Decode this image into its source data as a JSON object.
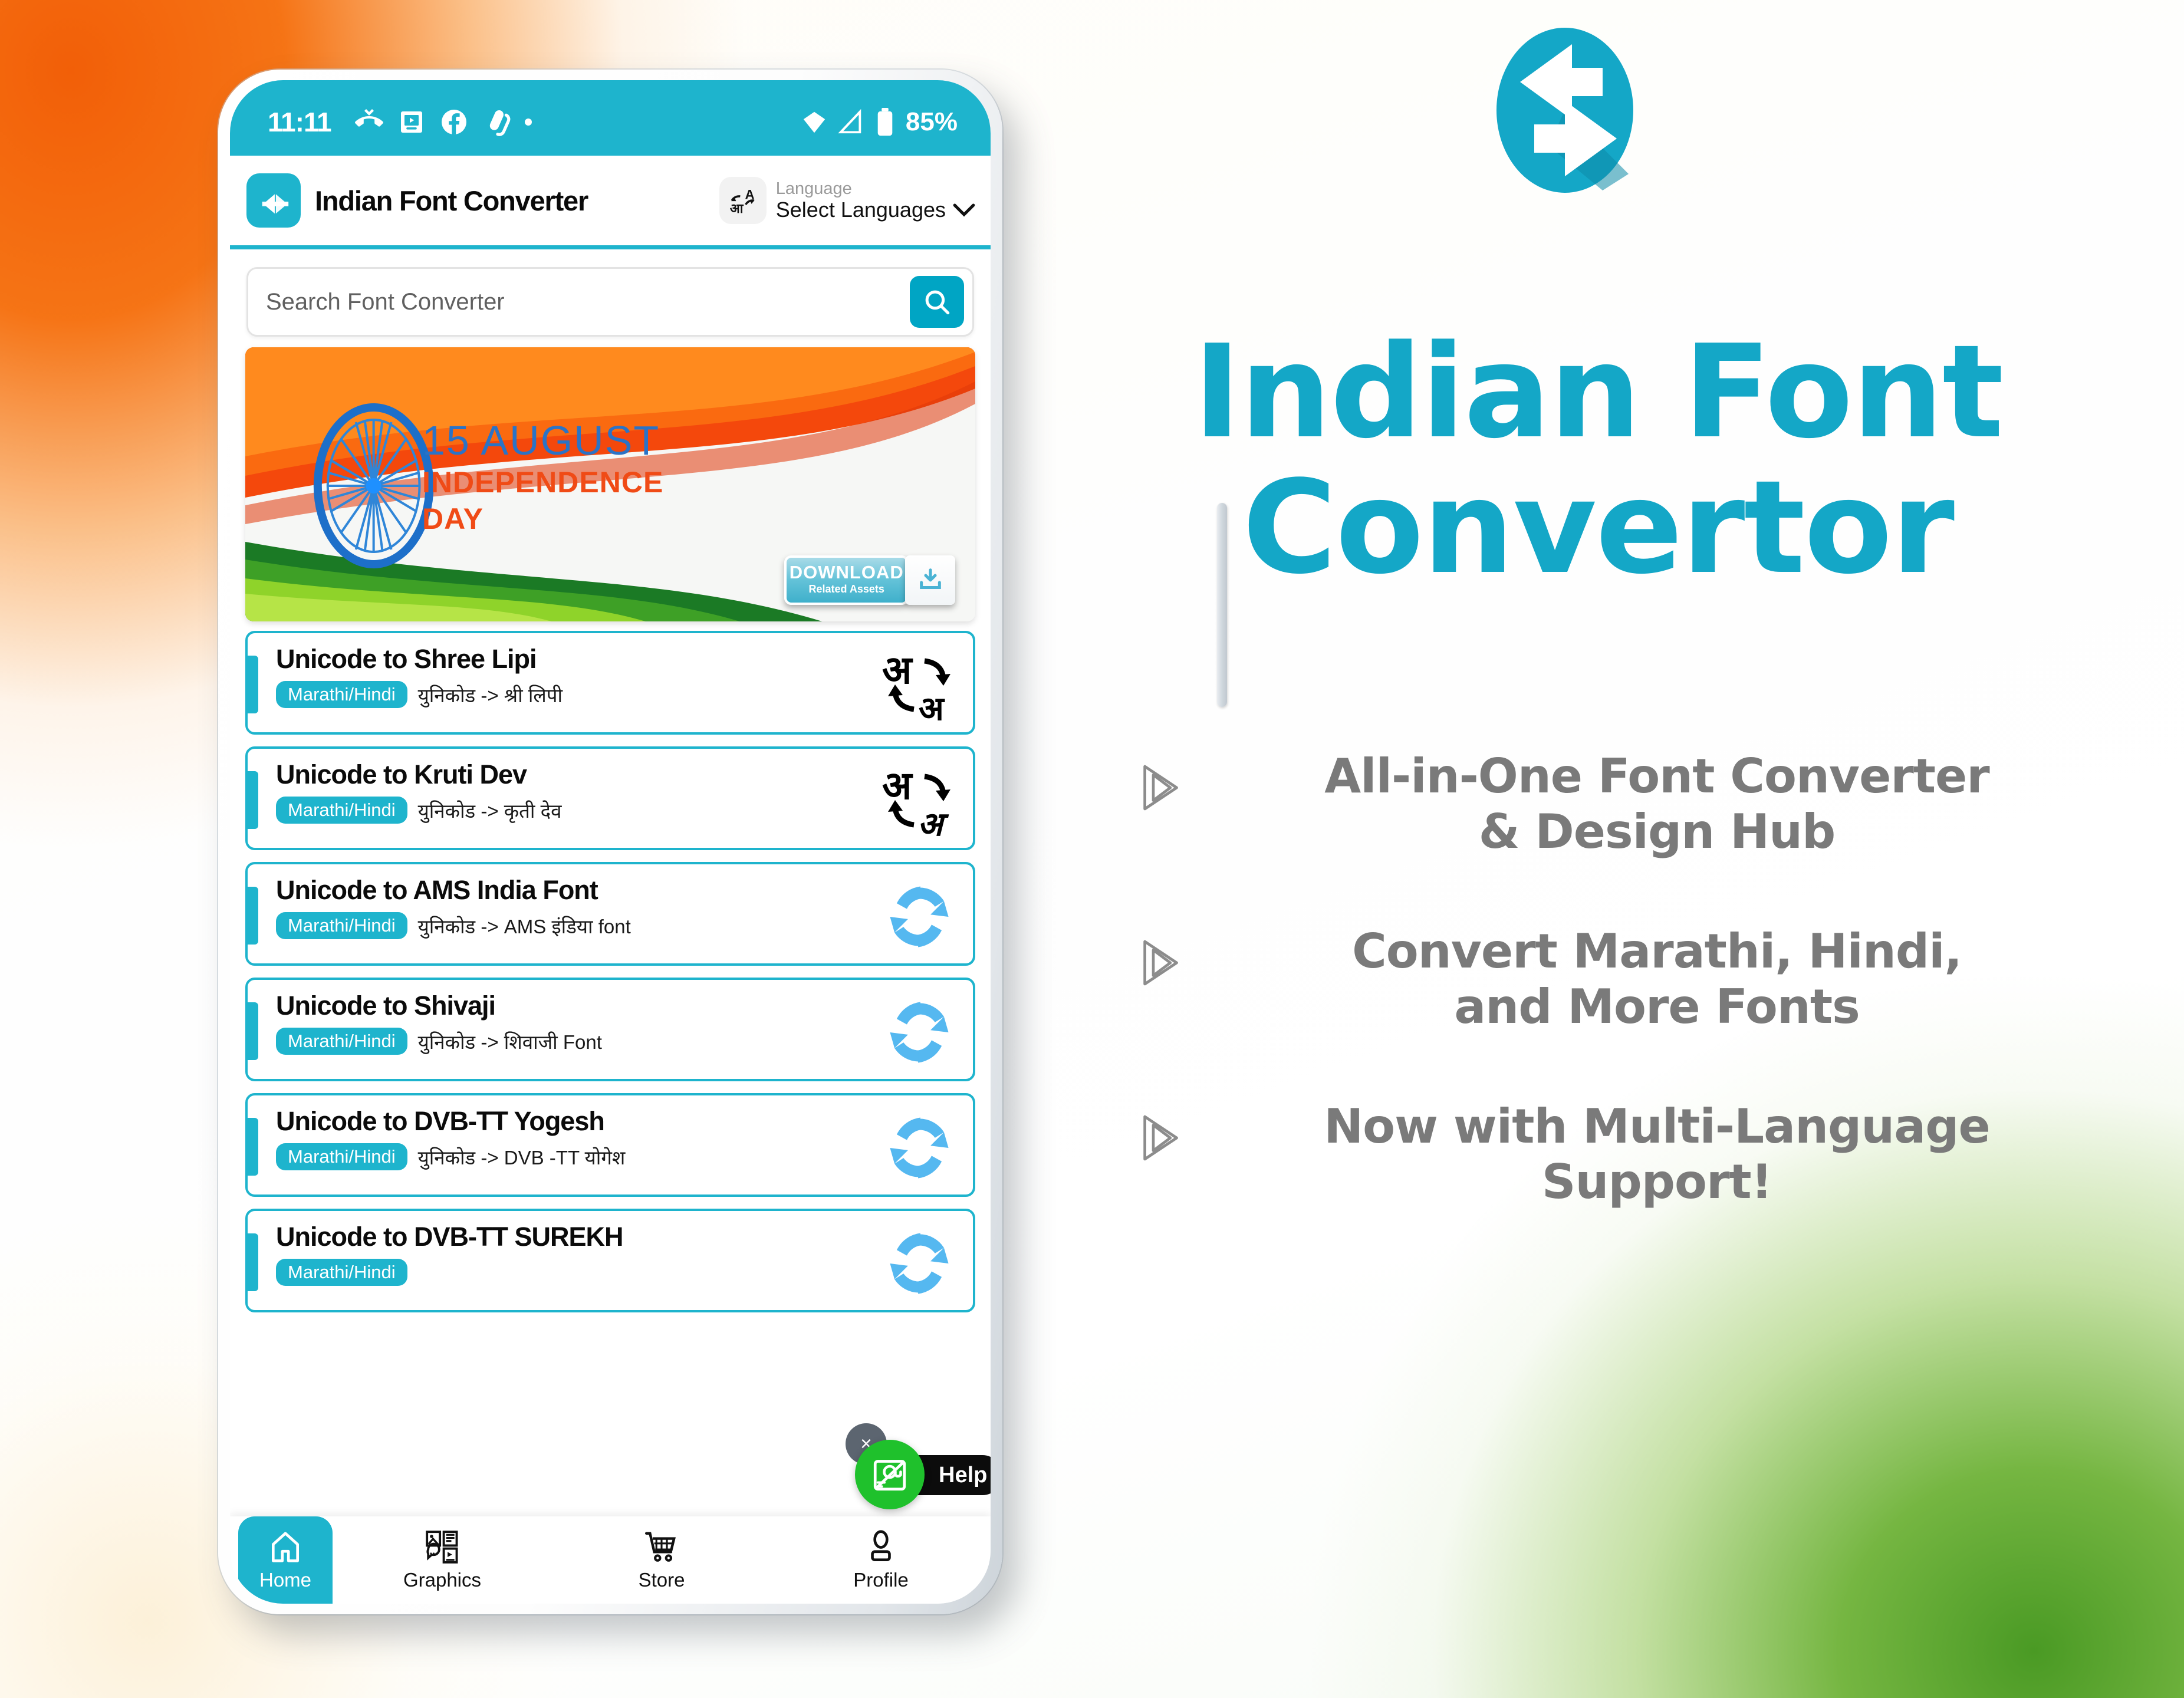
{
  "colors": {
    "brand_teal": "#1eb4cd",
    "brand_teal_dark": "#00a5c4",
    "promo_title": "#14a7c7",
    "feature_text": "#7a7a7a",
    "saffron": "#f25f08",
    "green": "#4a9a24",
    "help_green": "#1fc12c"
  },
  "phone": {
    "status_bar": {
      "time": "11:11",
      "battery": "85%",
      "icons": [
        "missed-call-icon",
        "cast-media-icon",
        "facebook-icon",
        "app-notification-icon",
        "dot-icon"
      ],
      "right_icons": [
        "wifi-icon",
        "signal-icon",
        "battery-icon"
      ]
    },
    "app_bar": {
      "logo_icon": "font-converter-logo-icon",
      "title": "Indian Font Converter",
      "language_icon": "translate-icon",
      "language_label": "Language",
      "language_value": "Select Languages",
      "chevron": "chevron-down-icon"
    },
    "search": {
      "value": "",
      "placeholder": "Search Font Converter",
      "button_icon": "search-icon"
    },
    "banner": {
      "line1": "15 AUGUST",
      "line2": "INDEPENDENCE",
      "line3": "DAY",
      "download_label": "DOWNLOAD",
      "download_sub": "Related Assets",
      "download_icon": "download-icon"
    },
    "list": [
      {
        "title": "Unicode to Shree Lipi",
        "chip": "Marathi/Hindi",
        "desc": "युनिकोड -> श्री लिपी",
        "icon": "devanagari-convert-icon",
        "glyph_top": "अ",
        "glyph_bottom": "अ"
      },
      {
        "title": "Unicode to Kruti Dev",
        "chip": "Marathi/Hindi",
        "desc": "युनिकोड -> कृती देव",
        "icon": "devanagari-convert-icon",
        "glyph_top": "अ",
        "glyph_bottom": "अ"
      },
      {
        "title": "Unicode to AMS India Font",
        "chip": "Marathi/Hindi",
        "desc": "युनिकोड -> AMS इंडिया font",
        "icon": "refresh-cycle-icon"
      },
      {
        "title": "Unicode to Shivaji",
        "chip": "Marathi/Hindi",
        "desc": "युनिकोड -> शिवाजी Font",
        "icon": "refresh-cycle-icon"
      },
      {
        "title": "Unicode to DVB-TT Yogesh",
        "chip": "Marathi/Hindi",
        "desc": "युनिकोड -> DVB -TT योगेश",
        "icon": "refresh-cycle-icon"
      },
      {
        "title": "Unicode to DVB-TT SUREKH",
        "chip": "Marathi/Hindi",
        "desc": "",
        "icon": "refresh-cycle-icon"
      }
    ],
    "help_fab": {
      "label": "Help",
      "icon": "email-envelope-icon",
      "close_label": "×"
    },
    "bottom_nav": [
      {
        "label": "Home",
        "icon": "home-icon",
        "active": true
      },
      {
        "label": "Graphics",
        "icon": "graphics-icon",
        "active": false
      },
      {
        "label": "Store",
        "icon": "shopping-cart-icon",
        "active": false
      },
      {
        "label": "Profile",
        "icon": "profile-person-icon",
        "active": false
      }
    ]
  },
  "promo": {
    "logo_icon": "font-converter-logo-icon",
    "title_line1": "Indian Font",
    "title_line2": "Convertor",
    "features": [
      {
        "icon": "chevron-bullet-icon",
        "text": "All-in-One Font Converter\n& Design Hub"
      },
      {
        "icon": "chevron-bullet-icon",
        "text": "Convert Marathi, Hindi,\nand More Fonts"
      },
      {
        "icon": "chevron-bullet-icon",
        "text": "Now with Multi-Language\nSupport!"
      }
    ]
  }
}
